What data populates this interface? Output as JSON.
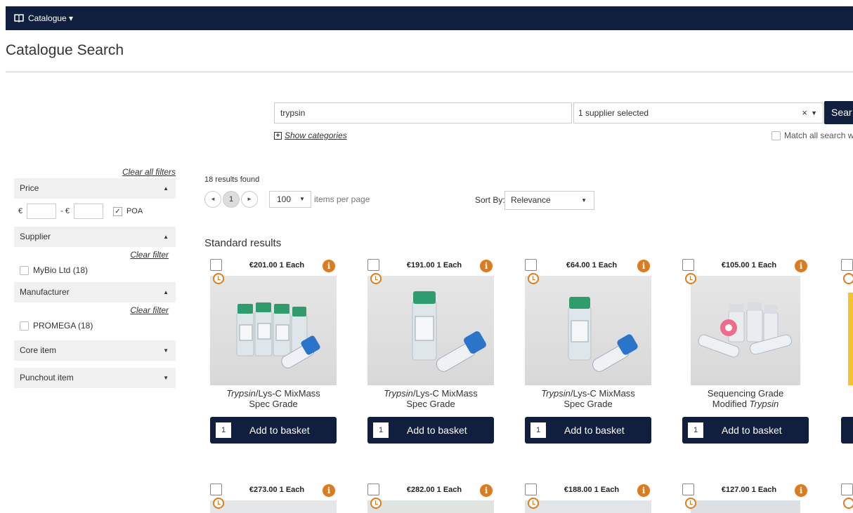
{
  "topbar": {
    "menu_label": "Catalogue ▾"
  },
  "page": {
    "title": "Catalogue Search"
  },
  "search": {
    "query": "trypsin",
    "supplier_select": "1 supplier selected",
    "clear_symbol": "×",
    "caret": "▼",
    "button_label": "Sear",
    "show_categories": "Show categories",
    "match_all": "Match all search w"
  },
  "sidebar": {
    "clear_all": "Clear all filters",
    "price": {
      "label": "Price",
      "currency": "€",
      "separator": "- €",
      "poa": "POA"
    },
    "supplier": {
      "label": "Supplier",
      "clear": "Clear filter",
      "option": "MyBio Ltd (18)"
    },
    "manufacturer": {
      "label": "Manufacturer",
      "clear": "Clear filter",
      "option": "PROMEGA (18)"
    },
    "core_item": {
      "label": "Core item"
    },
    "punchout_item": {
      "label": "Punchout item"
    },
    "arrow_up": "▲",
    "arrow_down": "▼"
  },
  "results": {
    "count": "18 results found",
    "page": "1",
    "prev": "◄",
    "next": "►",
    "per_page": "100",
    "per_page_label": "items per page",
    "sort_label": "Sort By:",
    "sort_value": "Relevance",
    "section": "Standard results"
  },
  "cards_row1": [
    {
      "price": "€201.00 1 Each",
      "name_em": "Trypsin",
      "name_rest": "/Lys-C MixMass",
      "name_line2": "Spec Grade",
      "qty": "1",
      "add": "Add to basket"
    },
    {
      "price": "€191.00 1 Each",
      "name_em": "Trypsin",
      "name_rest": "/Lys-C MixMass",
      "name_line2": "Spec Grade",
      "qty": "1",
      "add": "Add to basket"
    },
    {
      "price": "€64.00 1 Each",
      "name_em": "Trypsin",
      "name_rest": "/Lys-C MixMass",
      "name_line2": "Spec Grade",
      "qty": "1",
      "add": "Add to basket"
    },
    {
      "price": "€105.00 1 Each",
      "name_line1": "Sequencing Grade",
      "name_line2_pre": "Modified ",
      "name_line2_em": "Trypsin",
      "qty": "1",
      "add": "Add to basket"
    }
  ],
  "cards_row2": [
    {
      "price": "€273.00 1 Each"
    },
    {
      "price": "€282.00 1 Each"
    },
    {
      "price": "€188.00 1 Each"
    },
    {
      "price": "€127.00 1 Each"
    }
  ],
  "info_glyph": "i",
  "colors": {
    "navy": "#0f1f3d",
    "orange": "#e07b1a"
  }
}
